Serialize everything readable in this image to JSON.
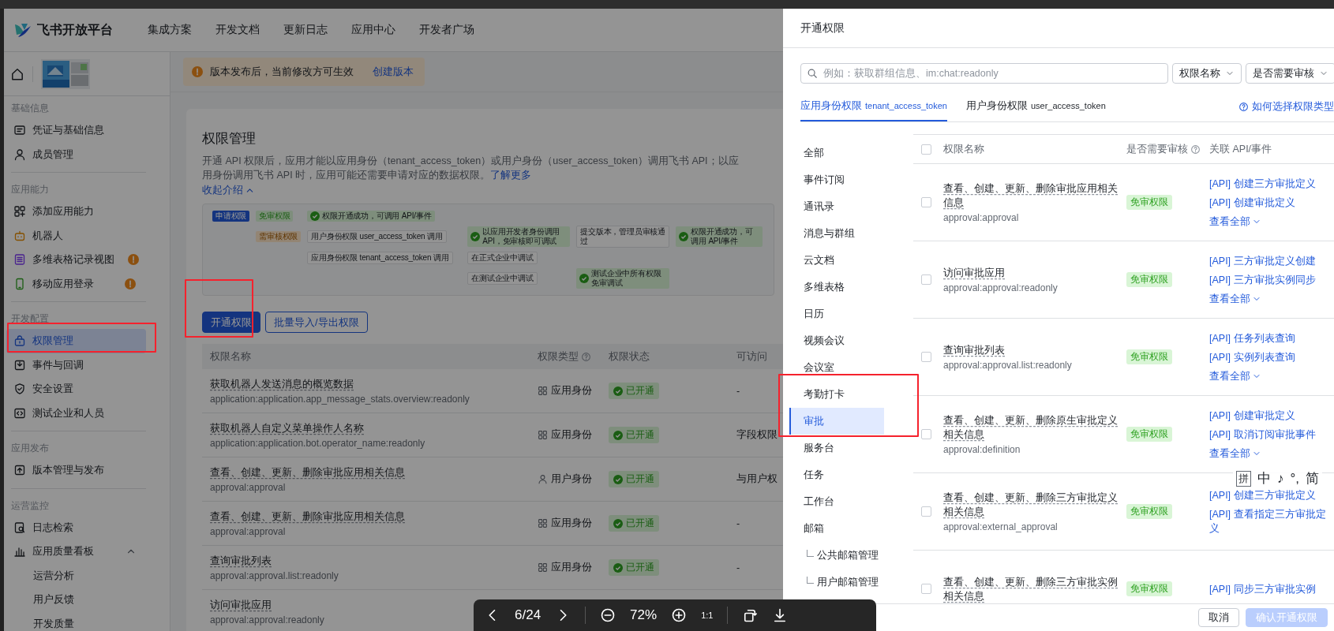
{
  "top_nav": {
    "brand": "飞书开放平台",
    "items": [
      "集成方案",
      "开发文档",
      "更新日志",
      "应用中心",
      "开发者广场"
    ]
  },
  "notice": {
    "text": "版本发布后，当前修改方可生效",
    "link": "创建版本"
  },
  "sidebar": {
    "sections": [
      {
        "title": "基础信息",
        "items": [
          {
            "label": "凭证与基础信息",
            "selected": false,
            "warning": false
          },
          {
            "label": "成员管理",
            "selected": false,
            "warning": false
          }
        ]
      },
      {
        "title": "应用能力",
        "items": [
          {
            "label": "添加应用能力",
            "selected": false,
            "warning": false
          },
          {
            "label": "机器人",
            "selected": false,
            "warning": false
          },
          {
            "label": "多维表格记录视图",
            "selected": false,
            "warning": true
          },
          {
            "label": "移动应用登录",
            "selected": false,
            "warning": true
          }
        ]
      },
      {
        "title": "开发配置",
        "items": [
          {
            "label": "权限管理",
            "selected": true,
            "warning": false
          },
          {
            "label": "事件与回调",
            "selected": false,
            "warning": false
          },
          {
            "label": "安全设置",
            "selected": false,
            "warning": false
          },
          {
            "label": "测试企业和人员",
            "selected": false,
            "warning": false
          }
        ]
      },
      {
        "title": "应用发布",
        "items": [
          {
            "label": "版本管理与发布",
            "selected": false,
            "warning": false
          }
        ]
      },
      {
        "title": "运营监控",
        "items": [
          {
            "label": "日志检索",
            "selected": false,
            "warning": false
          },
          {
            "label": "应用质量看板",
            "selected": false,
            "warning": false,
            "expanded": true,
            "children": [
              {
                "label": "运营分析",
                "selected": false
              },
              {
                "label": "用户反馈",
                "selected": false
              },
              {
                "label": "开发质量",
                "selected": false
              }
            ]
          }
        ]
      }
    ]
  },
  "page": {
    "title": "权限管理",
    "description": "开通 API 权限后，应用才能以应用身份（tenant_access_token）或用户身份（user_access_token）调用飞书 API；以应用身份调用飞书 API 时，应用可能还需要申请对应的数据权限。",
    "learn_more": "了解更多",
    "collapse": "收起介绍",
    "diagram": {
      "nodes": [
        {
          "text": "申请权限",
          "kind": "start"
        },
        {
          "text": "免审权限",
          "kind": "free"
        },
        {
          "text": "权限开通成功，可调用 API/事件",
          "kind": "success"
        },
        {
          "text": "需审核权限",
          "kind": "review"
        },
        {
          "text": "用户身份权限 user_access_token 调用",
          "kind": "step"
        },
        {
          "text": "以应用开发者身份调用 API，免审核即可调试",
          "kind": "success"
        },
        {
          "text": "提交版本，管理员审核通过",
          "kind": "step"
        },
        {
          "text": "权限开通成功，可调用 API/事件",
          "kind": "success"
        },
        {
          "text": "应用身份权限 tenant_access_token 调用",
          "kind": "step"
        },
        {
          "text": "在正式企业中调试",
          "kind": "step"
        },
        {
          "text": "在测试企业中调试",
          "kind": "step"
        },
        {
          "text": "测试企业中所有权限免审调试",
          "kind": "success"
        }
      ]
    },
    "buttons": [
      {
        "label": "开通权限",
        "kind": "primary"
      },
      {
        "label": "批量导入/导出权限",
        "kind": "outline"
      }
    ],
    "table": {
      "columns": [
        {
          "label": "权限名称",
          "help": false
        },
        {
          "label": "权限类型",
          "help": true
        },
        {
          "label": "权限状态",
          "help": false
        },
        {
          "label": "可访问",
          "help": false
        }
      ],
      "rows": [
        {
          "name": "获取机器人发送消息的概览数据",
          "scope": "application:application.app_message_stats.overview:readonly",
          "identity": "应用身份",
          "kind": "app",
          "status": "已开通",
          "enabled": true,
          "access": "-"
        },
        {
          "name": "获取机器人自定义菜单操作人名称",
          "scope": "application:application.bot.operator_name:readonly",
          "identity": "应用身份",
          "kind": "app",
          "status": "已开通",
          "enabled": true,
          "access": "字段权限"
        },
        {
          "name": "查看、创建、更新、删除审批应用相关信息",
          "scope": "approval:approval",
          "identity": "用户身份",
          "kind": "user",
          "status": "已开通",
          "enabled": true,
          "access": "与用户权"
        },
        {
          "name": "查看、创建、更新、删除审批应用相关信息",
          "scope": "approval:approval",
          "identity": "应用身份",
          "kind": "app",
          "status": "已开通",
          "enabled": true,
          "access": "-"
        },
        {
          "name": "查询审批列表",
          "scope": "approval:approval.list:readonly",
          "identity": "应用身份",
          "kind": "app",
          "status": "已开通",
          "enabled": true,
          "access": "-"
        },
        {
          "name": "访问审批应用",
          "scope": "approval:approval:readonly"
        }
      ]
    }
  },
  "drawer": {
    "mask": true,
    "title": "开通权限",
    "search": {
      "placeholder": "例如：获取群组信息、im:chat:readonly"
    },
    "filters": [
      "权限名称",
      "是否需要审核"
    ],
    "tabs": [
      {
        "label": "应用身份权限",
        "token": "tenant_access_token",
        "selected": true
      },
      {
        "label": "用户身份权限",
        "token": "user_access_token",
        "selected": false
      }
    ],
    "help_link": "如何选择权限类型",
    "categories": [
      {
        "label": "全部",
        "selected": false
      },
      {
        "label": "事件订阅",
        "selected": false
      },
      {
        "label": "通讯录",
        "selected": false
      },
      {
        "label": "消息与群组",
        "selected": false
      },
      {
        "label": "云文档",
        "selected": false
      },
      {
        "label": "多维表格",
        "selected": false
      },
      {
        "label": "日历",
        "selected": false
      },
      {
        "label": "视频会议",
        "selected": false
      },
      {
        "label": "会议室",
        "selected": false
      },
      {
        "label": "考勤打卡",
        "selected": false
      },
      {
        "label": "审批",
        "selected": true
      },
      {
        "label": "服务台",
        "selected": false
      },
      {
        "label": "任务",
        "selected": false
      },
      {
        "label": "工作台",
        "selected": false
      },
      {
        "label": "邮箱",
        "selected": false,
        "children": [
          {
            "label": "公共邮箱管理",
            "selected": false
          },
          {
            "label": "用户邮箱管理",
            "selected": false
          }
        ]
      }
    ],
    "columns": [
      {
        "label": "权限名称",
        "help": false
      },
      {
        "label": "是否需要审核",
        "help": true
      },
      {
        "label": "关联 API/事件",
        "help": false
      }
    ],
    "select_all_checked": false,
    "rows": [
      {
        "checked": false,
        "name": "查看、创建、更新、删除审批应用相关信息",
        "scope": "approval:approval",
        "review": "免审权限",
        "links": [
          "[API] 创建三方审批定义",
          "[API] 创建审批定义"
        ],
        "more": "查看全部"
      },
      {
        "checked": false,
        "name": "访问审批应用",
        "scope": "approval:approval:readonly",
        "review": "免审权限",
        "links": [
          "[API] 三方审批定义创建",
          "[API] 三方审批实例同步"
        ],
        "more": "查看全部"
      },
      {
        "checked": false,
        "name": "查询审批列表",
        "scope": "approval:approval.list:readonly",
        "review": "免审权限",
        "links": [
          "[API] 任务列表查询",
          "[API] 实例列表查询"
        ],
        "more": "查看全部"
      },
      {
        "checked": false,
        "name": "查看、创建、更新、删除原生审批定义相关信息",
        "scope": "approval:definition",
        "review": "免审权限",
        "links": [
          "[API] 创建审批定义",
          "[API] 取消订阅审批事件"
        ],
        "more": "查看全部"
      },
      {
        "checked": false,
        "name": "查看、创建、更新、删除三方审批定义相关信息",
        "scope": "approval:external_approval",
        "review": "免审权限",
        "links": [
          "[API] 创建三方审批定义",
          "[API] 查看指定三方审批定义"
        ]
      },
      {
        "checked": false,
        "name": "查看、创建、更新、删除三方审批实例相关信息",
        "review": "免审权限",
        "links": [
          "[API] 同步三方审批实例"
        ]
      }
    ],
    "footer_buttons": [
      {
        "label": "取消",
        "kind": "default",
        "disabled": false
      },
      {
        "label": "确认开通权限",
        "kind": "primary",
        "disabled": true
      }
    ]
  },
  "ime_bar": {
    "items": [
      "拼",
      "中",
      "♪",
      "°,",
      "简"
    ]
  },
  "viewer_bar": {
    "page": "6/24",
    "zoom": "72%",
    "actual_size": "1:1"
  },
  "highlight_boxes": [
    {
      "color": "#f5222d"
    },
    {
      "color": "#f5222d"
    },
    {
      "color": "#f5222d"
    }
  ]
}
